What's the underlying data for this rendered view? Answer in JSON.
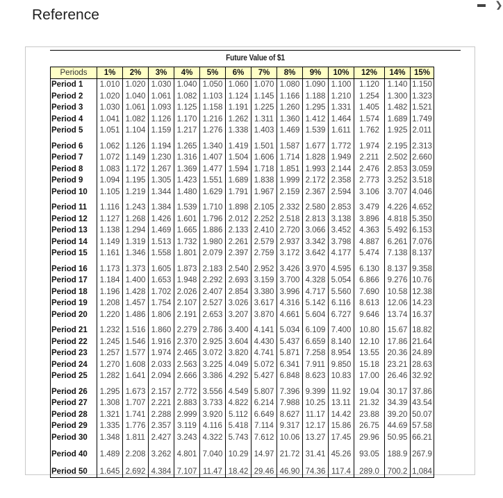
{
  "window": {
    "title": "Reference",
    "minimize_icon": "minimize-icon",
    "close_icon": "close-icon"
  },
  "table": {
    "caption": "Future Value of $1",
    "header": [
      "Periods",
      "1%",
      "2%",
      "3%",
      "4%",
      "5%",
      "6%",
      "7%",
      "8%",
      "9%",
      "10%",
      "12%",
      "14%",
      "15%"
    ],
    "rows": [
      {
        "label": "Period 1",
        "values": [
          "1.010",
          "1.020",
          "1.030",
          "1.040",
          "1.050",
          "1.060",
          "1.070",
          "1.080",
          "1.090",
          "1.100",
          "1.120",
          "1.140",
          "1.150"
        ]
      },
      {
        "label": "Period 2",
        "values": [
          "1.020",
          "1.040",
          "1.061",
          "1.082",
          "1.103",
          "1.124",
          "1.145",
          "1.166",
          "1.188",
          "1.210",
          "1.254",
          "1.300",
          "1.323"
        ]
      },
      {
        "label": "Period 3",
        "values": [
          "1.030",
          "1.061",
          "1.093",
          "1.125",
          "1.158",
          "1.191",
          "1.225",
          "1.260",
          "1.295",
          "1.331",
          "1.405",
          "1.482",
          "1.521"
        ]
      },
      {
        "label": "Period 4",
        "values": [
          "1.041",
          "1.082",
          "1.126",
          "1.170",
          "1.216",
          "1.262",
          "1.311",
          "1.360",
          "1.412",
          "1.464",
          "1.574",
          "1.689",
          "1.749"
        ]
      },
      {
        "label": "Period 5",
        "values": [
          "1.051",
          "1.104",
          "1.159",
          "1.217",
          "1.276",
          "1.338",
          "1.403",
          "1.469",
          "1.539",
          "1.611",
          "1.762",
          "1.925",
          "2.011"
        ]
      },
      {
        "label": "Period 6",
        "values": [
          "1.062",
          "1.126",
          "1.194",
          "1.265",
          "1.340",
          "1.419",
          "1.501",
          "1.587",
          "1.677",
          "1.772",
          "1.974",
          "2.195",
          "2.313"
        ]
      },
      {
        "label": "Period 7",
        "values": [
          "1.072",
          "1.149",
          "1.230",
          "1.316",
          "1.407",
          "1.504",
          "1.606",
          "1.714",
          "1.828",
          "1.949",
          "2.211",
          "2.502",
          "2.660"
        ]
      },
      {
        "label": "Period 8",
        "values": [
          "1.083",
          "1.172",
          "1.267",
          "1.369",
          "1.477",
          "1.594",
          "1.718",
          "1.851",
          "1.993",
          "2.144",
          "2.476",
          "2.853",
          "3.059"
        ]
      },
      {
        "label": "Period 9",
        "values": [
          "1.094",
          "1.195",
          "1.305",
          "1.423",
          "1.551",
          "1.689",
          "1.838",
          "1.999",
          "2.172",
          "2.358",
          "2.773",
          "3.252",
          "3.518"
        ]
      },
      {
        "label": "Period 10",
        "values": [
          "1.105",
          "1.219",
          "1.344",
          "1.480",
          "1.629",
          "1.791",
          "1.967",
          "2.159",
          "2.367",
          "2.594",
          "3.106",
          "3.707",
          "4.046"
        ]
      },
      {
        "label": "Period 11",
        "values": [
          "1.116",
          "1.243",
          "1.384",
          "1.539",
          "1.710",
          "1.898",
          "2.105",
          "2.332",
          "2.580",
          "2.853",
          "3.479",
          "4.226",
          "4.652"
        ]
      },
      {
        "label": "Period 12",
        "values": [
          "1.127",
          "1.268",
          "1.426",
          "1.601",
          "1.796",
          "2.012",
          "2.252",
          "2.518",
          "2.813",
          "3.138",
          "3.896",
          "4.818",
          "5.350"
        ]
      },
      {
        "label": "Period 13",
        "values": [
          "1.138",
          "1.294",
          "1.469",
          "1.665",
          "1.886",
          "2.133",
          "2.410",
          "2.720",
          "3.066",
          "3.452",
          "4.363",
          "5.492",
          "6.153"
        ]
      },
      {
        "label": "Period 14",
        "values": [
          "1.149",
          "1.319",
          "1.513",
          "1.732",
          "1.980",
          "2.261",
          "2.579",
          "2.937",
          "3.342",
          "3.798",
          "4.887",
          "6.261",
          "7.076"
        ]
      },
      {
        "label": "Period 15",
        "values": [
          "1.161",
          "1.346",
          "1.558",
          "1.801",
          "2.079",
          "2.397",
          "2.759",
          "3.172",
          "3.642",
          "4.177",
          "5.474",
          "7.138",
          "8.137"
        ]
      },
      {
        "label": "Period 16",
        "values": [
          "1.173",
          "1.373",
          "1.605",
          "1.873",
          "2.183",
          "2.540",
          "2.952",
          "3.426",
          "3.970",
          "4.595",
          "6.130",
          "8.137",
          "9.358"
        ]
      },
      {
        "label": "Period 17",
        "values": [
          "1.184",
          "1.400",
          "1.653",
          "1.948",
          "2.292",
          "2.693",
          "3.159",
          "3.700",
          "4.328",
          "5.054",
          "6.866",
          "9.276",
          "10.76"
        ]
      },
      {
        "label": "Period 18",
        "values": [
          "1.196",
          "1.428",
          "1.702",
          "2.026",
          "2.407",
          "2.854",
          "3.380",
          "3.996",
          "4.717",
          "5.560",
          "7.690",
          "10.58",
          "12.38"
        ]
      },
      {
        "label": "Period 19",
        "values": [
          "1.208",
          "1.457",
          "1.754",
          "2.107",
          "2.527",
          "3.026",
          "3.617",
          "4.316",
          "5.142",
          "6.116",
          "8.613",
          "12.06",
          "14.23"
        ]
      },
      {
        "label": "Period 20",
        "values": [
          "1.220",
          "1.486",
          "1.806",
          "2.191",
          "2.653",
          "3.207",
          "3.870",
          "4.661",
          "5.604",
          "6.727",
          "9.646",
          "13.74",
          "16.37"
        ]
      },
      {
        "label": "Period 21",
        "values": [
          "1.232",
          "1.516",
          "1.860",
          "2.279",
          "2.786",
          "3.400",
          "4.141",
          "5.034",
          "6.109",
          "7.400",
          "10.80",
          "15.67",
          "18.82"
        ]
      },
      {
        "label": "Period 22",
        "values": [
          "1.245",
          "1.546",
          "1.916",
          "2.370",
          "2.925",
          "3.604",
          "4.430",
          "5.437",
          "6.659",
          "8.140",
          "12.10",
          "17.86",
          "21.64"
        ]
      },
      {
        "label": "Period 23",
        "values": [
          "1.257",
          "1.577",
          "1.974",
          "2.465",
          "3.072",
          "3.820",
          "4.741",
          "5.871",
          "7.258",
          "8.954",
          "13.55",
          "20.36",
          "24.89"
        ]
      },
      {
        "label": "Period 24",
        "values": [
          "1.270",
          "1.608",
          "2.033",
          "2.563",
          "3.225",
          "4.049",
          "5.072",
          "6.341",
          "7.911",
          "9.850",
          "15.18",
          "23.21",
          "28.63"
        ]
      },
      {
        "label": "Period 25",
        "values": [
          "1.282",
          "1.641",
          "2.094",
          "2.666",
          "3.386",
          "4.292",
          "5.427",
          "6.848",
          "8.623",
          "10.83",
          "17.00",
          "26.46",
          "32.92"
        ]
      },
      {
        "label": "Period 26",
        "values": [
          "1.295",
          "1.673",
          "2.157",
          "2.772",
          "3.556",
          "4.549",
          "5.807",
          "7.396",
          "9.399",
          "11.92",
          "19.04",
          "30.17",
          "37.86"
        ]
      },
      {
        "label": "Period 27",
        "values": [
          "1.308",
          "1.707",
          "2.221",
          "2.883",
          "3.733",
          "4.822",
          "6.214",
          "7.988",
          "10.25",
          "13.11",
          "21.32",
          "34.39",
          "43.54"
        ]
      },
      {
        "label": "Period 28",
        "values": [
          "1.321",
          "1.741",
          "2.288",
          "2.999",
          "3.920",
          "5.112",
          "6.649",
          "8.627",
          "11.17",
          "14.42",
          "23.88",
          "39.20",
          "50.07"
        ]
      },
      {
        "label": "Period 29",
        "values": [
          "1.335",
          "1.776",
          "2.357",
          "3.119",
          "4.116",
          "5.418",
          "7.114",
          "9.317",
          "12.17",
          "15.86",
          "26.75",
          "44.69",
          "57.58"
        ]
      },
      {
        "label": "Period 30",
        "values": [
          "1.348",
          "1.811",
          "2.427",
          "3.243",
          "4.322",
          "5.743",
          "7.612",
          "10.06",
          "13.27",
          "17.45",
          "29.96",
          "50.95",
          "66.21"
        ]
      },
      {
        "label": "Period 40",
        "values": [
          "1.489",
          "2.208",
          "3.262",
          "4.801",
          "7.040",
          "10.29",
          "14.97",
          "21.72",
          "31.41",
          "45.26",
          "93.05",
          "188.9",
          "267.9"
        ]
      },
      {
        "label": "Period 50",
        "values": [
          "1.645",
          "2.692",
          "4.384",
          "7.107",
          "11.47",
          "18.42",
          "29.46",
          "46.90",
          "74.36",
          "117.4",
          "289.0",
          "700.2",
          "1,084"
        ]
      }
    ]
  },
  "colors": {
    "header_bg": "#ffffc6",
    "border": "#000000",
    "frame_border": "#c8c8c8"
  }
}
